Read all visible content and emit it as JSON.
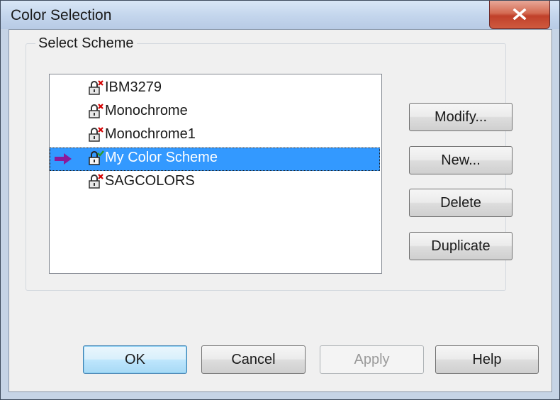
{
  "window": {
    "title": "Color Selection"
  },
  "group": {
    "label": "Select Scheme"
  },
  "schemes": [
    {
      "name": "IBM3279",
      "status": "locked-red-x",
      "selected": false
    },
    {
      "name": "Monochrome",
      "status": "locked-red-x",
      "selected": false
    },
    {
      "name": "Monochrome1",
      "status": "locked-red-x",
      "selected": false
    },
    {
      "name": "My Color Scheme",
      "status": "active-green-check",
      "selected": true
    },
    {
      "name": "SAGCOLORS",
      "status": "locked-red-x",
      "selected": false
    }
  ],
  "side_buttons": {
    "modify": "Modify...",
    "new": "New...",
    "delete": "Delete",
    "duplicate": "Duplicate"
  },
  "bottom_buttons": {
    "ok": "OK",
    "cancel": "Cancel",
    "apply": "Apply",
    "help": "Help"
  },
  "colors": {
    "selection": "#3399ff",
    "arrow": "#8b1a9b",
    "x_mark": "#d40000",
    "check_mark": "#2a9a2a"
  }
}
